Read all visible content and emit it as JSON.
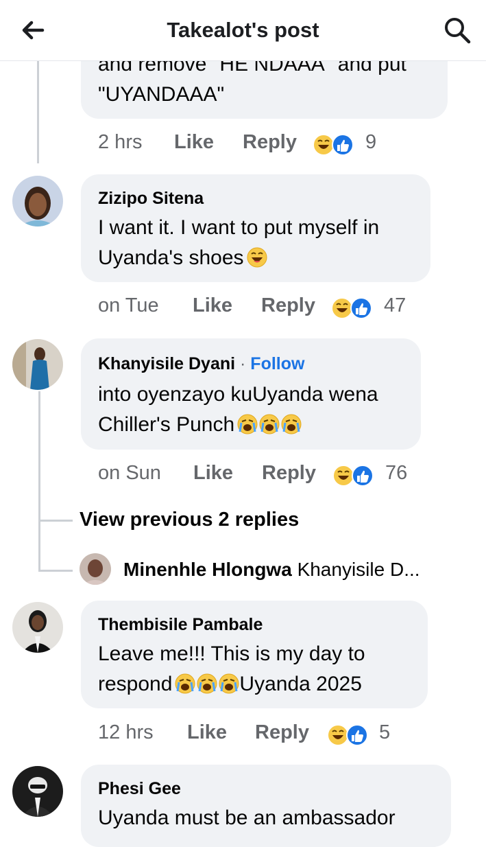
{
  "header": {
    "title": "Takealot's post",
    "back_icon": "arrow-left-icon",
    "search_icon": "search-icon"
  },
  "comment0": {
    "text_line1": "and remove \"HE NDAAA\" and put",
    "text_line2": "\"UYANDAAA\"",
    "time": "2 hrs",
    "like": "Like",
    "reply": "Reply",
    "count": "9"
  },
  "comment1": {
    "name": "Zizipo Sitena",
    "text_line1": "I want it. I want to put myself in",
    "text_line2": "Uyanda's shoes",
    "time": "on Tue",
    "like": "Like",
    "reply": "Reply",
    "count": "47"
  },
  "comment2": {
    "name": "Khanyisile Dyani",
    "follow": "Follow",
    "text_line1": "into oyenzayo kuUyanda wena",
    "text_line2": "Chiller's Punch",
    "time": "on Sun",
    "like": "Like",
    "reply": "Reply",
    "count": "76"
  },
  "view_replies": "View previous 2 replies",
  "reply_preview": {
    "name": "Minenhle Hlongwa",
    "text": "Khanyisile D..."
  },
  "comment3": {
    "name": "Thembisile Pambale",
    "text_line1": "Leave me!!! This is my day to",
    "text_line2_prefix": "respond",
    "text_line2_suffix": "Uyanda 2025",
    "time": "12 hrs",
    "like": "Like",
    "reply": "Reply",
    "count": "5"
  },
  "comment4": {
    "name": "Phesi Gee",
    "text_line1": "Uyanda must be an ambassador"
  },
  "colors": {
    "reaction_blue": "#1b74e4",
    "bubble": "#f0f2f5",
    "meta_gray": "#65676b"
  }
}
